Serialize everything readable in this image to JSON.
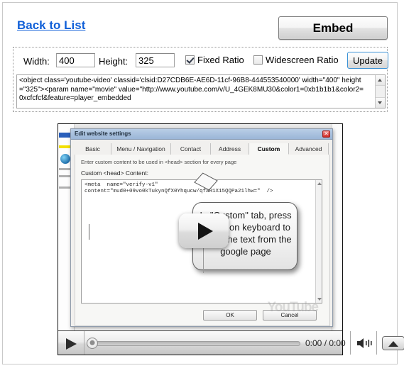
{
  "header": {
    "back_link": "Back to List",
    "embed_button": "Embed"
  },
  "settings": {
    "width_label": "Width:",
    "width_value": "400",
    "height_label": "Height:",
    "height_value": "325",
    "fixed_ratio_label": "Fixed Ratio",
    "fixed_ratio_checked": true,
    "widescreen_ratio_label": "Widescreen Ratio",
    "widescreen_ratio_checked": false,
    "update_button": "Update",
    "embed_code": "<object class='youtube-video' classid='clsid:D27CDB6E-AE6D-11cf-96B8-444553540000' width=\"400\" height=\"325\"><param name=\"movie\" value=\"http://www.youtube.com/v/U_4GEK8MU30&color1=0xb1b1b1&color2=0xcfcfcf&feature=player_embedded"
  },
  "video": {
    "callout_text": "In \"Custom\" tab, press Ctrl+V on keyboard to paste the text from the google page",
    "watermark": "YouTube",
    "player": {
      "time_display": "0:00 / 0:00",
      "play_label": "Play"
    },
    "dialog": {
      "title": "Edit website settings",
      "tabs": [
        {
          "label": "Basic",
          "active": false
        },
        {
          "label": "Menu / Navigation",
          "active": false
        },
        {
          "label": "Contact",
          "active": false
        },
        {
          "label": "Address",
          "active": false
        },
        {
          "label": "Custom",
          "active": true
        },
        {
          "label": "Advanced",
          "active": false
        }
      ],
      "hint": "Enter custom content to be used in <head> section for every page",
      "field_label": "Custom <head> Content:",
      "code": "<meta  name=\"verify-v1\"\ncontent=\"mud0+09vo0kTukynQfX0Yhqucw/qfaR1X15QQPa21lhw=\"  />",
      "ok_button": "OK",
      "cancel_button": "Cancel"
    }
  }
}
